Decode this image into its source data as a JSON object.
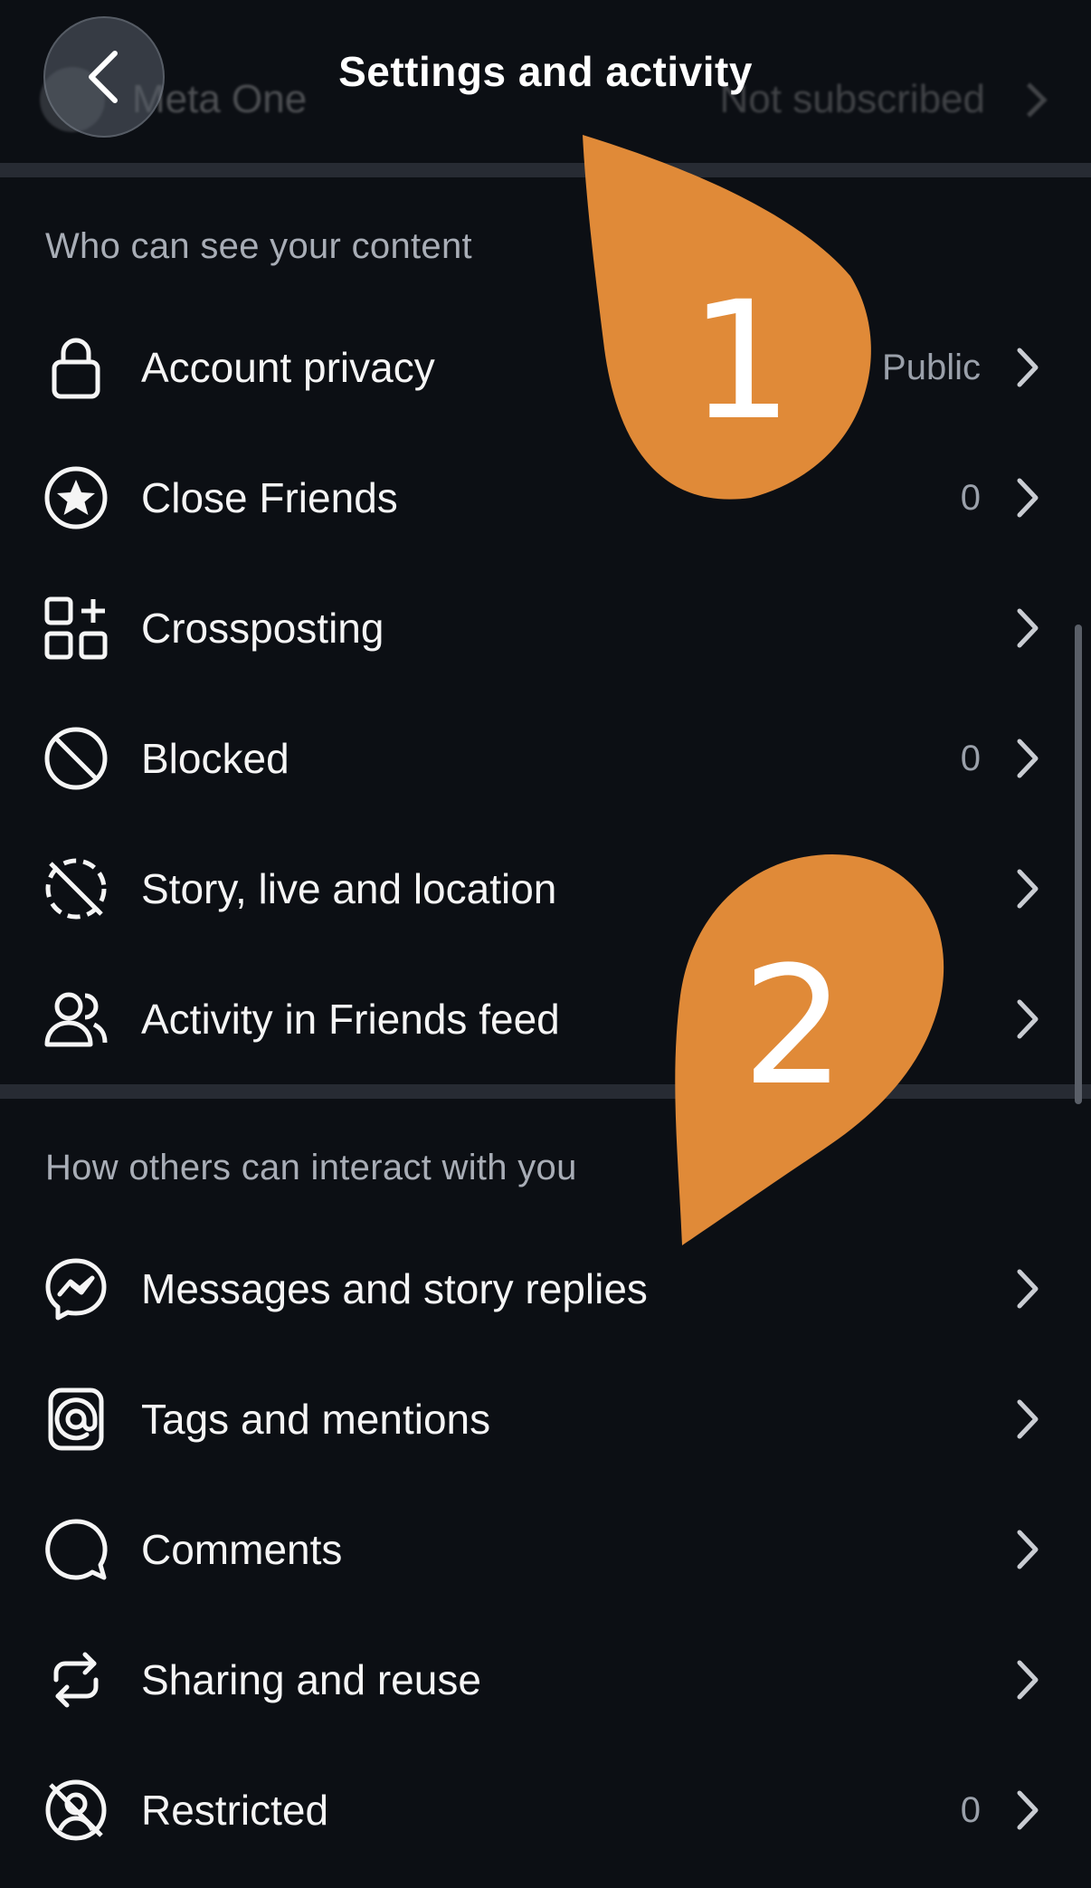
{
  "header": {
    "title": "Settings and activity",
    "behind_row": {
      "name": "Meta One",
      "status": "Not subscribed"
    },
    "back_icon": "chevron-left-icon"
  },
  "sections": [
    {
      "title": "Who can see your content",
      "items": [
        {
          "label": "Account privacy",
          "value": "Public",
          "icon": "lock-icon"
        },
        {
          "label": "Close Friends",
          "value": "0",
          "icon": "star-circle-icon"
        },
        {
          "label": "Crossposting",
          "value": "",
          "icon": "grid-plus-icon"
        },
        {
          "label": "Blocked",
          "value": "0",
          "icon": "blocked-icon"
        },
        {
          "label": "Story, live and location",
          "value": "",
          "icon": "story-off-icon"
        },
        {
          "label": "Activity in Friends feed",
          "value": "",
          "icon": "friends-icon"
        }
      ]
    },
    {
      "title": "How others can interact with you",
      "items": [
        {
          "label": "Messages and story replies",
          "value": "",
          "icon": "messenger-icon"
        },
        {
          "label": "Tags and mentions",
          "value": "",
          "icon": "at-sign-icon"
        },
        {
          "label": "Comments",
          "value": "",
          "icon": "comment-bubble-icon"
        },
        {
          "label": "Sharing and reuse",
          "value": "",
          "icon": "repost-icon"
        },
        {
          "label": "Restricted",
          "value": "0",
          "icon": "restricted-icon"
        }
      ]
    }
  ],
  "callouts": [
    {
      "number": "1",
      "color": "#e08a38"
    },
    {
      "number": "2",
      "color": "#e08a38"
    }
  ],
  "colors": {
    "background": "#0c0f14",
    "divider": "#272b33",
    "section_title": "#a8adb6",
    "value_text": "#9aa0aa",
    "accent_callout": "#e08a38"
  }
}
